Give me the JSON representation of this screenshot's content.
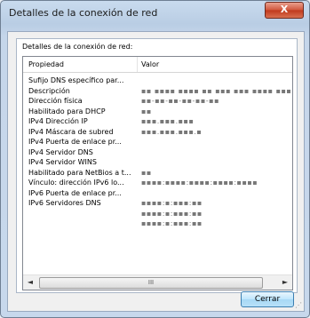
{
  "window": {
    "title": "Detalles de la conexión de red",
    "close_label": "X"
  },
  "group": {
    "label": "Detalles de la conexión de red:"
  },
  "table": {
    "headers": {
      "property": "Propiedad",
      "value": "Valor"
    },
    "rows": [
      {
        "property": "Sufijo DNS específico par...",
        "value": ""
      },
      {
        "property": "Descripción",
        "value": "▪▪ ▪▪▪▪ ▪▪▪▪ ▪▪ ▪▪▪ ▪▪▪ ▪▪▪▪ ▪▪▪▪▪▪ ▪▪▪"
      },
      {
        "property": "Dirección física",
        "value": "▪▪-▪▪-▪▪-▪▪-▪▪-▪▪"
      },
      {
        "property": "Habilitado para DHCP",
        "value": "▪▪"
      },
      {
        "property": "IPv4 Dirección IP",
        "value": "▪▪▪.▪▪▪.▪▪▪"
      },
      {
        "property": "IPv4 Máscara de subred",
        "value": "▪▪▪.▪▪▪.▪▪▪.▪"
      },
      {
        "property": "IPv4 Puerta de enlace pr...",
        "value": ""
      },
      {
        "property": "IPv4 Servidor DNS",
        "value": ""
      },
      {
        "property": "IPv4 Servidor WINS",
        "value": ""
      },
      {
        "property": "Habilitado para NetBios a t...",
        "value": "▪▪"
      },
      {
        "property": "Vínculo: dirección IPv6 lo...",
        "value": "▪▪▪▪:▪▪▪▪:▪▪▪▪:▪▪▪▪:▪▪▪▪"
      },
      {
        "property": "IPv6 Puerta de enlace pr...",
        "value": ""
      },
      {
        "property": "IPv6 Servidores DNS",
        "value": "▪▪▪▪:▪:▪▪▪:▪▪"
      },
      {
        "property": "",
        "value": "▪▪▪▪:▪:▪▪▪:▪▪"
      },
      {
        "property": "",
        "value": "▪▪▪▪:▪:▪▪▪:▪▪"
      }
    ]
  },
  "scrollbar": {
    "left_arrow": "◄",
    "right_arrow": "►",
    "thumb_grip": "III"
  },
  "buttons": {
    "close": "Cerrar"
  }
}
